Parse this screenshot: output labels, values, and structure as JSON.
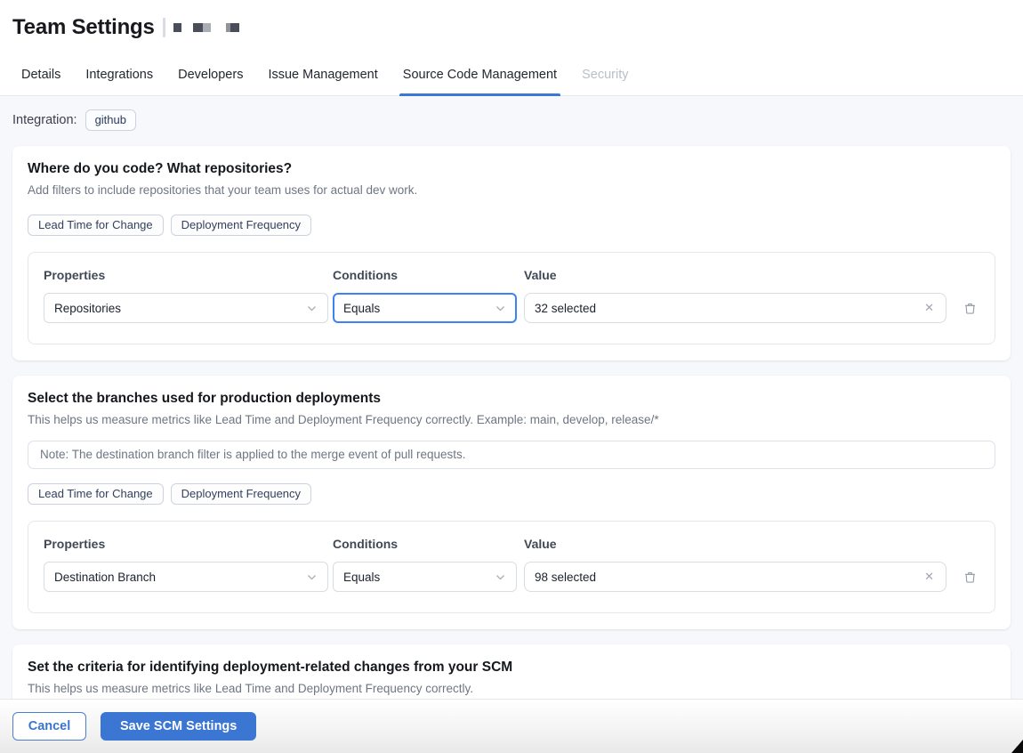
{
  "header": {
    "title": "Team Settings"
  },
  "tabs": [
    {
      "label": "Details",
      "state": "normal"
    },
    {
      "label": "Integrations",
      "state": "normal"
    },
    {
      "label": "Developers",
      "state": "normal"
    },
    {
      "label": "Issue Management",
      "state": "normal"
    },
    {
      "label": "Source Code Management",
      "state": "active"
    },
    {
      "label": "Security",
      "state": "disabled"
    }
  ],
  "integration": {
    "label": "Integration:",
    "value": "github"
  },
  "sections": [
    {
      "title": "Where do you code? What repositories?",
      "description": "Add filters to include repositories that your team uses for actual dev work.",
      "metric_badges": [
        "Lead Time for Change",
        "Deployment Frequency"
      ],
      "filter": {
        "properties_label": "Properties",
        "conditions_label": "Conditions",
        "value_label": "Value",
        "property": "Repositories",
        "condition": "Equals",
        "value": "32 selected"
      }
    },
    {
      "title": "Select the branches used for production deployments",
      "description": "This helps us measure metrics like Lead Time and Deployment Frequency correctly. Example: main, develop, release/*",
      "note": "Note: The destination branch filter is applied to the merge event of pull requests.",
      "metric_badges": [
        "Lead Time for Change",
        "Deployment Frequency"
      ],
      "filter": {
        "properties_label": "Properties",
        "conditions_label": "Conditions",
        "value_label": "Value",
        "property": "Destination Branch",
        "condition": "Equals",
        "value": "98 selected"
      }
    },
    {
      "title": "Set the criteria for identifying deployment-related changes from your SCM",
      "description": "This helps us measure metrics like Lead Time and Deployment Frequency correctly."
    }
  ],
  "footer": {
    "cancel_label": "Cancel",
    "save_label": "Save SCM Settings"
  },
  "colors": {
    "accent_blue": "#3b76d3",
    "focus_blue": "#3c82f0",
    "page_background": "#f7f8fb"
  }
}
